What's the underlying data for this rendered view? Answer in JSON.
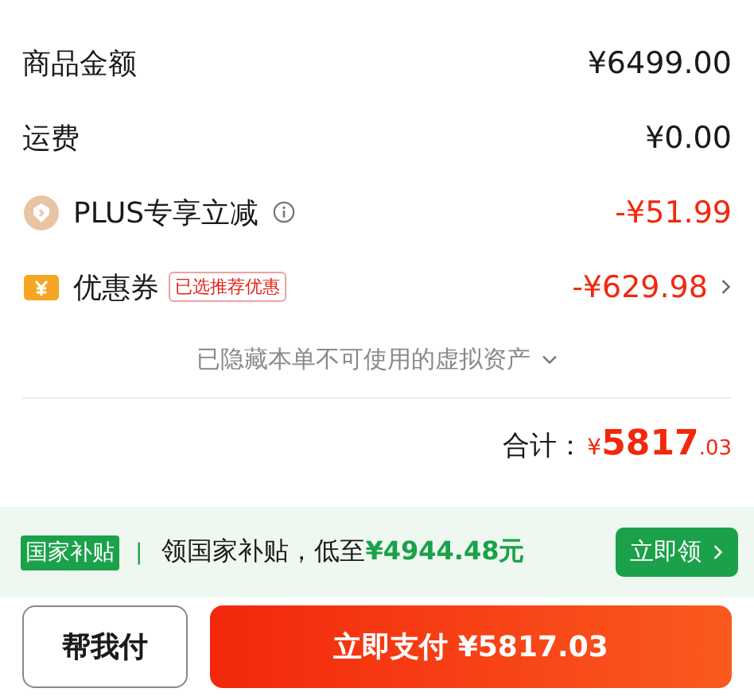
{
  "rows": [
    {
      "kind": "plain",
      "label": "商品金额",
      "amount": "¥6499.00",
      "discount": false
    },
    {
      "kind": "plain",
      "label": "运费",
      "amount": "¥0.00",
      "discount": false
    },
    {
      "kind": "plus",
      "label": "PLUS专享立减",
      "amount": "-¥51.99",
      "discount": true
    },
    {
      "kind": "coupon",
      "label": "优惠券",
      "tag": "已选推荐优惠",
      "amount": "-¥629.98",
      "discount": true
    }
  ],
  "hidden_note": "已隐藏本单不可使用的虚拟资产",
  "total": {
    "label": "合计：",
    "currency": "¥",
    "integer": "5817",
    "decimal": ".03"
  },
  "subsidy": {
    "tag": "国家补贴",
    "separator": "|",
    "text": "领国家补贴，低至",
    "highlight": "¥4944.48元",
    "button": "立即领"
  },
  "actions": {
    "secondary": "帮我付",
    "primary": "立即支付 ¥5817.03"
  }
}
